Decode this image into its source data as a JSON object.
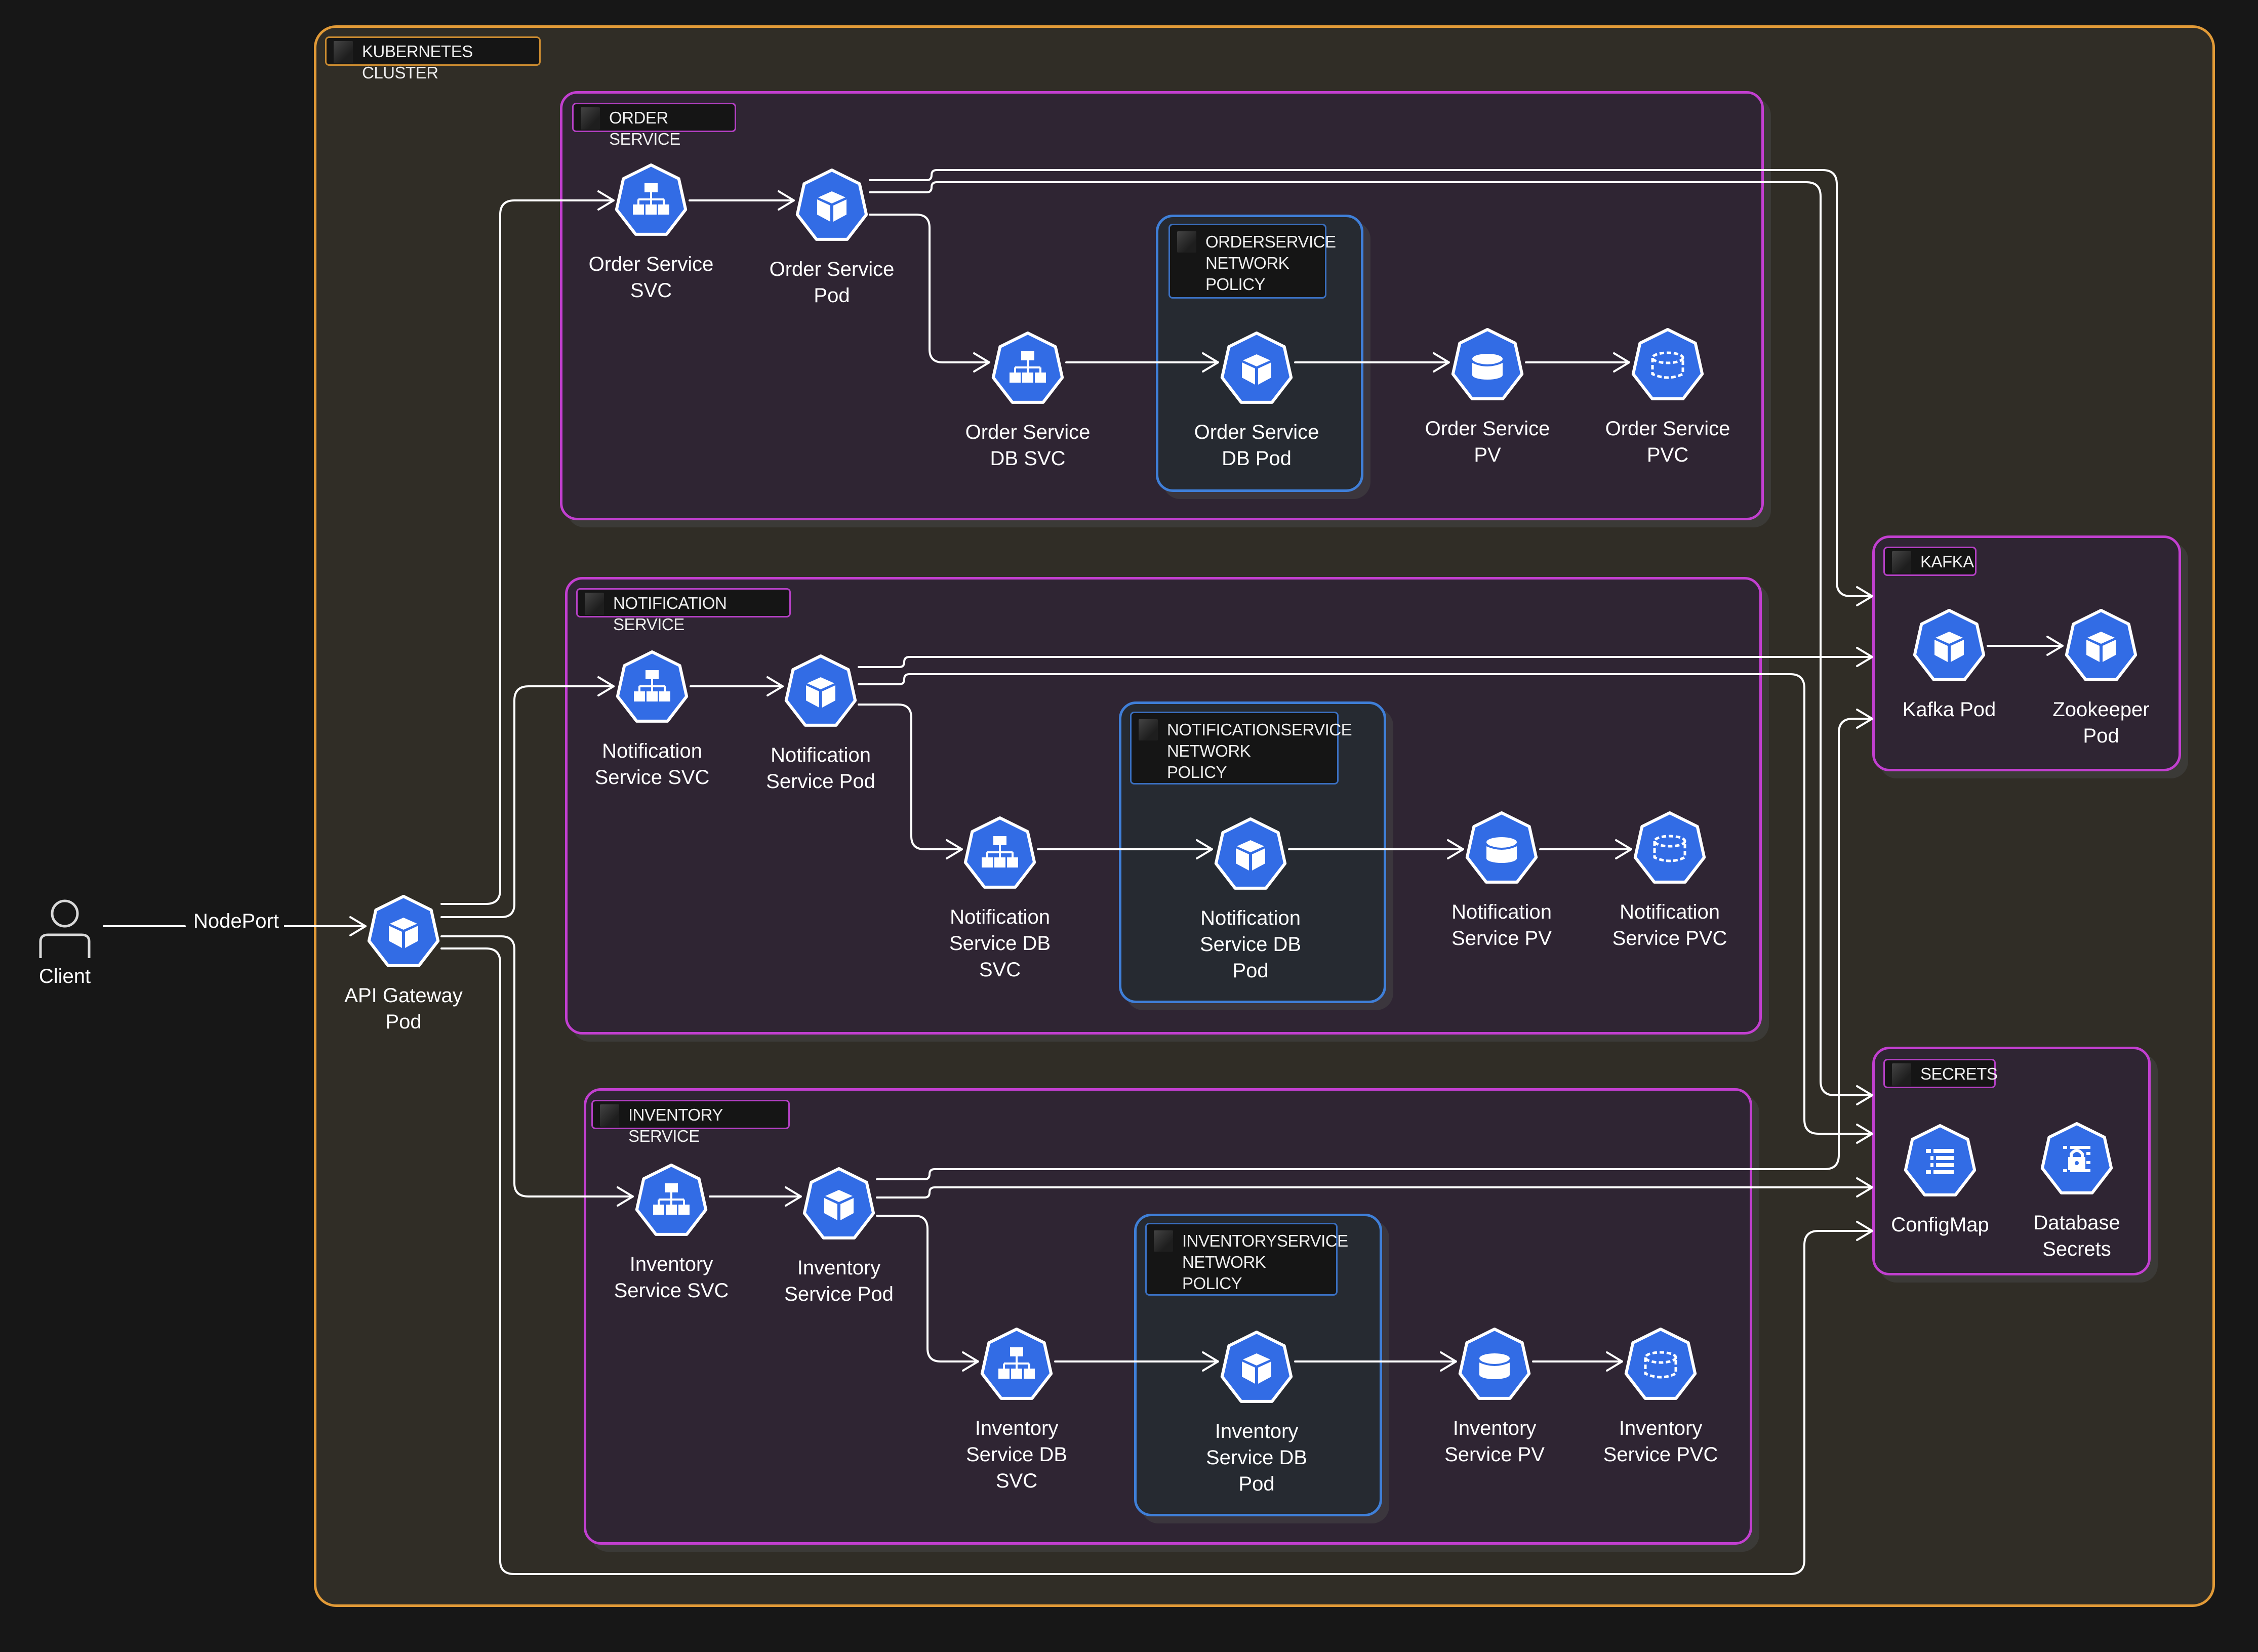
{
  "colors": {
    "background": "#171717",
    "cluster_fill": "#302d26",
    "cluster_border": "#e19a37",
    "service_group_fill": "#2f2533",
    "service_group_border": "#c23fd0",
    "policy_fill": "#262a31",
    "policy_border": "#3f7fd8",
    "node_fill": "#326ce5",
    "edge": "#ffffff"
  },
  "client": {
    "label": "Client",
    "icon": "user-icon"
  },
  "edge_labels": {
    "nodeport": "NodePort"
  },
  "cluster": {
    "title": "KUBERNETES CLUSTER"
  },
  "api_gateway": {
    "label": "API Gateway\nPod",
    "icon": "pod-icon"
  },
  "groups": {
    "order": {
      "title": "ORDER SERVICE",
      "policy_title": "ORDERSERVICE\nNETWORK\nPOLICY",
      "nodes": {
        "svc": {
          "label": "Order Service\nSVC",
          "icon": "service-icon"
        },
        "pod": {
          "label": "Order Service\nPod",
          "icon": "pod-icon"
        },
        "db_svc": {
          "label": "Order Service\nDB SVC",
          "icon": "service-icon"
        },
        "db_pod": {
          "label": "Order Service\nDB Pod",
          "icon": "pod-icon"
        },
        "pv": {
          "label": "Order Service\nPV",
          "icon": "persistent-volume-icon"
        },
        "pvc": {
          "label": "Order Service\nPVC",
          "icon": "persistent-volume-claim-icon"
        }
      }
    },
    "notification": {
      "title": "NOTIFICATION SERVICE",
      "policy_title": "NOTIFICATIONSERVICE\nNETWORK\nPOLICY",
      "nodes": {
        "svc": {
          "label": "Notification\nService SVC",
          "icon": "service-icon"
        },
        "pod": {
          "label": "Notification\nService Pod",
          "icon": "pod-icon"
        },
        "db_svc": {
          "label": "Notification\nService DB\nSVC",
          "icon": "service-icon"
        },
        "db_pod": {
          "label": "Notification\nService DB\nPod",
          "icon": "pod-icon"
        },
        "pv": {
          "label": "Notification\nService PV",
          "icon": "persistent-volume-icon"
        },
        "pvc": {
          "label": "Notification\nService PVC",
          "icon": "persistent-volume-claim-icon"
        }
      }
    },
    "inventory": {
      "title": "INVENTORY SERVICE",
      "policy_title": "INVENTORYSERVICE\nNETWORK\nPOLICY",
      "nodes": {
        "svc": {
          "label": "Inventory\nService SVC",
          "icon": "service-icon"
        },
        "pod": {
          "label": "Inventory\nService Pod",
          "icon": "pod-icon"
        },
        "db_svc": {
          "label": "Inventory\nService DB\nSVC",
          "icon": "service-icon"
        },
        "db_pod": {
          "label": "Inventory\nService DB\nPod",
          "icon": "pod-icon"
        },
        "pv": {
          "label": "Inventory\nService PV",
          "icon": "persistent-volume-icon"
        },
        "pvc": {
          "label": "Inventory\nService PVC",
          "icon": "persistent-volume-claim-icon"
        }
      }
    },
    "kafka": {
      "title": "KAFKA",
      "nodes": {
        "kafka_pod": {
          "label": "Kafka Pod",
          "icon": "pod-icon"
        },
        "zookeeper_pod": {
          "label": "Zookeeper\nPod",
          "icon": "pod-icon"
        }
      }
    },
    "secrets": {
      "title": "SECRETS",
      "nodes": {
        "configmap": {
          "label": "ConfigMap",
          "icon": "configmap-icon"
        },
        "db_secrets": {
          "label": "Database\nSecrets",
          "icon": "secret-icon"
        }
      }
    }
  },
  "connections": [
    [
      "Client",
      "API Gateway Pod",
      "NodePort"
    ],
    [
      "API Gateway Pod",
      "Order Service SVC"
    ],
    [
      "API Gateway Pod",
      "Notification Service SVC"
    ],
    [
      "API Gateway Pod",
      "Inventory Service SVC"
    ],
    [
      "API Gateway Pod",
      "Secrets"
    ],
    [
      "Order Service SVC",
      "Order Service Pod"
    ],
    [
      "Order Service Pod",
      "Order Service DB SVC"
    ],
    [
      "Order Service Pod",
      "Kafka"
    ],
    [
      "Order Service Pod",
      "Secrets"
    ],
    [
      "Order Service DB SVC",
      "Order Service DB Pod"
    ],
    [
      "Order Service DB Pod",
      "Order Service PV"
    ],
    [
      "Order Service PV",
      "Order Service PVC"
    ],
    [
      "Notification Service SVC",
      "Notification Service Pod"
    ],
    [
      "Notification Service Pod",
      "Notification Service DB SVC"
    ],
    [
      "Notification Service Pod",
      "Kafka"
    ],
    [
      "Notification Service Pod",
      "Secrets"
    ],
    [
      "Notification Service DB SVC",
      "Notification Service DB Pod"
    ],
    [
      "Notification Service DB Pod",
      "Notification Service PV"
    ],
    [
      "Notification Service PV",
      "Notification Service PVC"
    ],
    [
      "Inventory Service SVC",
      "Inventory Service Pod"
    ],
    [
      "Inventory Service Pod",
      "Inventory Service DB SVC"
    ],
    [
      "Inventory Service Pod",
      "Kafka"
    ],
    [
      "Inventory Service Pod",
      "Secrets"
    ],
    [
      "Inventory Service DB SVC",
      "Inventory Service DB Pod"
    ],
    [
      "Inventory Service DB Pod",
      "Inventory Service PV"
    ],
    [
      "Inventory Service PV",
      "Inventory Service PVC"
    ],
    [
      "Kafka Pod",
      "Zookeeper Pod"
    ]
  ]
}
